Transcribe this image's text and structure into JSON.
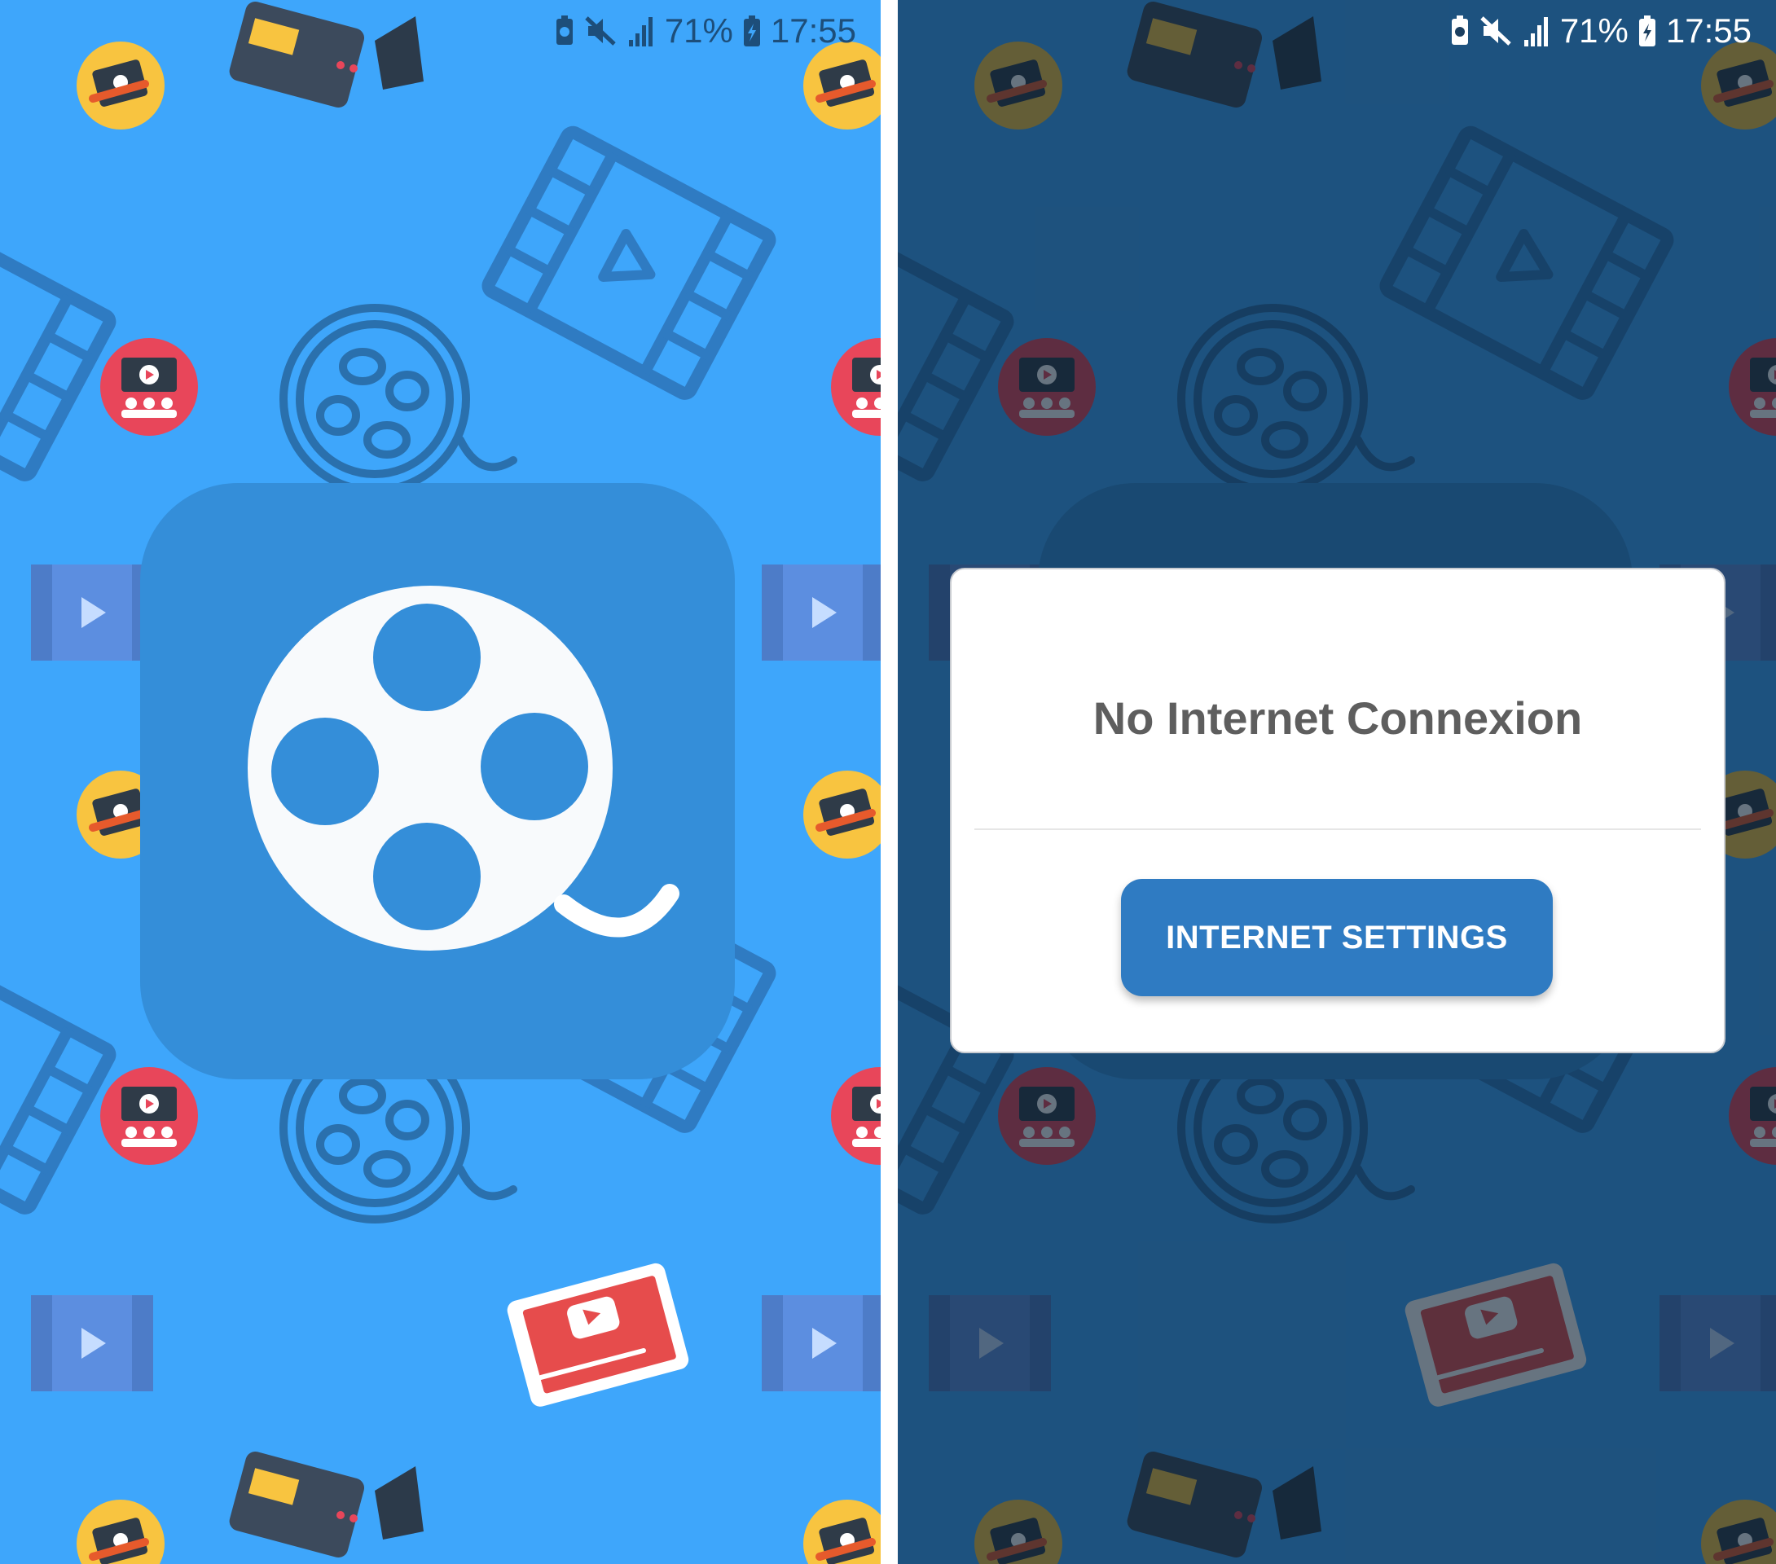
{
  "status_bar": {
    "battery_percent": "71%",
    "time": "17:55",
    "icons": [
      "battery-saver-icon",
      "mute-icon",
      "signal-icon",
      "charging-battery-icon"
    ]
  },
  "splash": {
    "logo_icon": "film-reel-icon",
    "background_color": "#3ea6fb",
    "tile_color": "#348ed9"
  },
  "dialog": {
    "title": "No Internet Connexion",
    "button_label": "INTERNET SETTINGS",
    "button_color": "#2f7bc2"
  }
}
